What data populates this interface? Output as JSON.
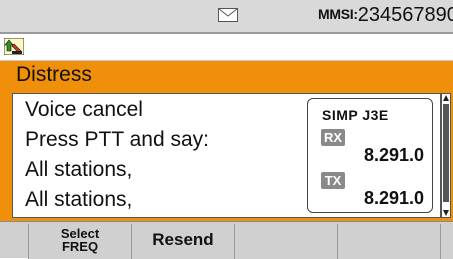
{
  "status_bar": {
    "mmsi_label": "MMSI:",
    "mmsi_value": "234567890"
  },
  "icons": {
    "status_message": "envelope-icon",
    "transaction": "transaction-arrow-icon"
  },
  "title": "Distress",
  "message_lines": [
    "Voice cancel",
    "Press PTT and say:",
    "All stations,",
    "All stations,"
  ],
  "channel": {
    "mode": "SIMP J3E",
    "rx_label": "RX",
    "rx_freq": "8.291.0",
    "tx_label": "TX",
    "tx_freq": "8.291.0"
  },
  "softkeys": [
    {
      "line1": "Select",
      "line2": "FREQ"
    },
    {
      "label": "Resend"
    },
    {
      "label": ""
    },
    {
      "label": ""
    },
    {
      "label": ""
    }
  ],
  "colors": {
    "accent": "#f0900a",
    "status_bar_bg": "#d9d9d9",
    "softkey_bg": "#d0d0d0"
  }
}
